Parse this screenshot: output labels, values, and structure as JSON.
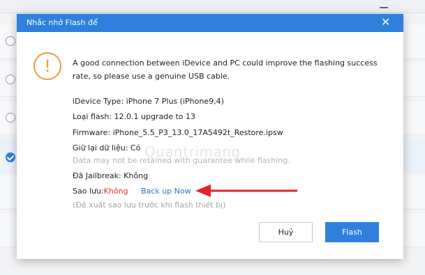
{
  "dialog": {
    "title": "Nhắc nhở Flash để",
    "close_glyph": "✕",
    "message": "A good connection between iDevice and PC could improve the flashing success rate, so please use a genuine USB cable.",
    "device_type": "iDevice Type: iPhone 7 Plus (iPhone9,4)",
    "flash_type": "Loại flash:  12.0.1 upgrade to 13",
    "firmware": "Firmware: iPhone_5.5_P3_13.0_17A5492t_Restore.ipsw",
    "keep_data": "Giữ lại dữ liệu: Có",
    "data_note": "Data may not be retained with guarantee while flashing.",
    "jailbreak": "Đã Jailbreak: Không",
    "backup_label": "Sao lưu:",
    "backup_value": "Không",
    "backup_link": "Back up Now",
    "backup_hint": "(Đề xuất sao lưu trước khi flash thiết bị)",
    "cancel_label": "Huỷ",
    "flash_label": "Flash",
    "warning_glyph": "!"
  },
  "watermark": "Quantrimang",
  "colors": {
    "titlebar": "#2f80dc",
    "warning": "#f09a3e",
    "backup_no": "#e0322e",
    "link": "#2a76d2",
    "annotation_arrow": "#e0242b"
  }
}
